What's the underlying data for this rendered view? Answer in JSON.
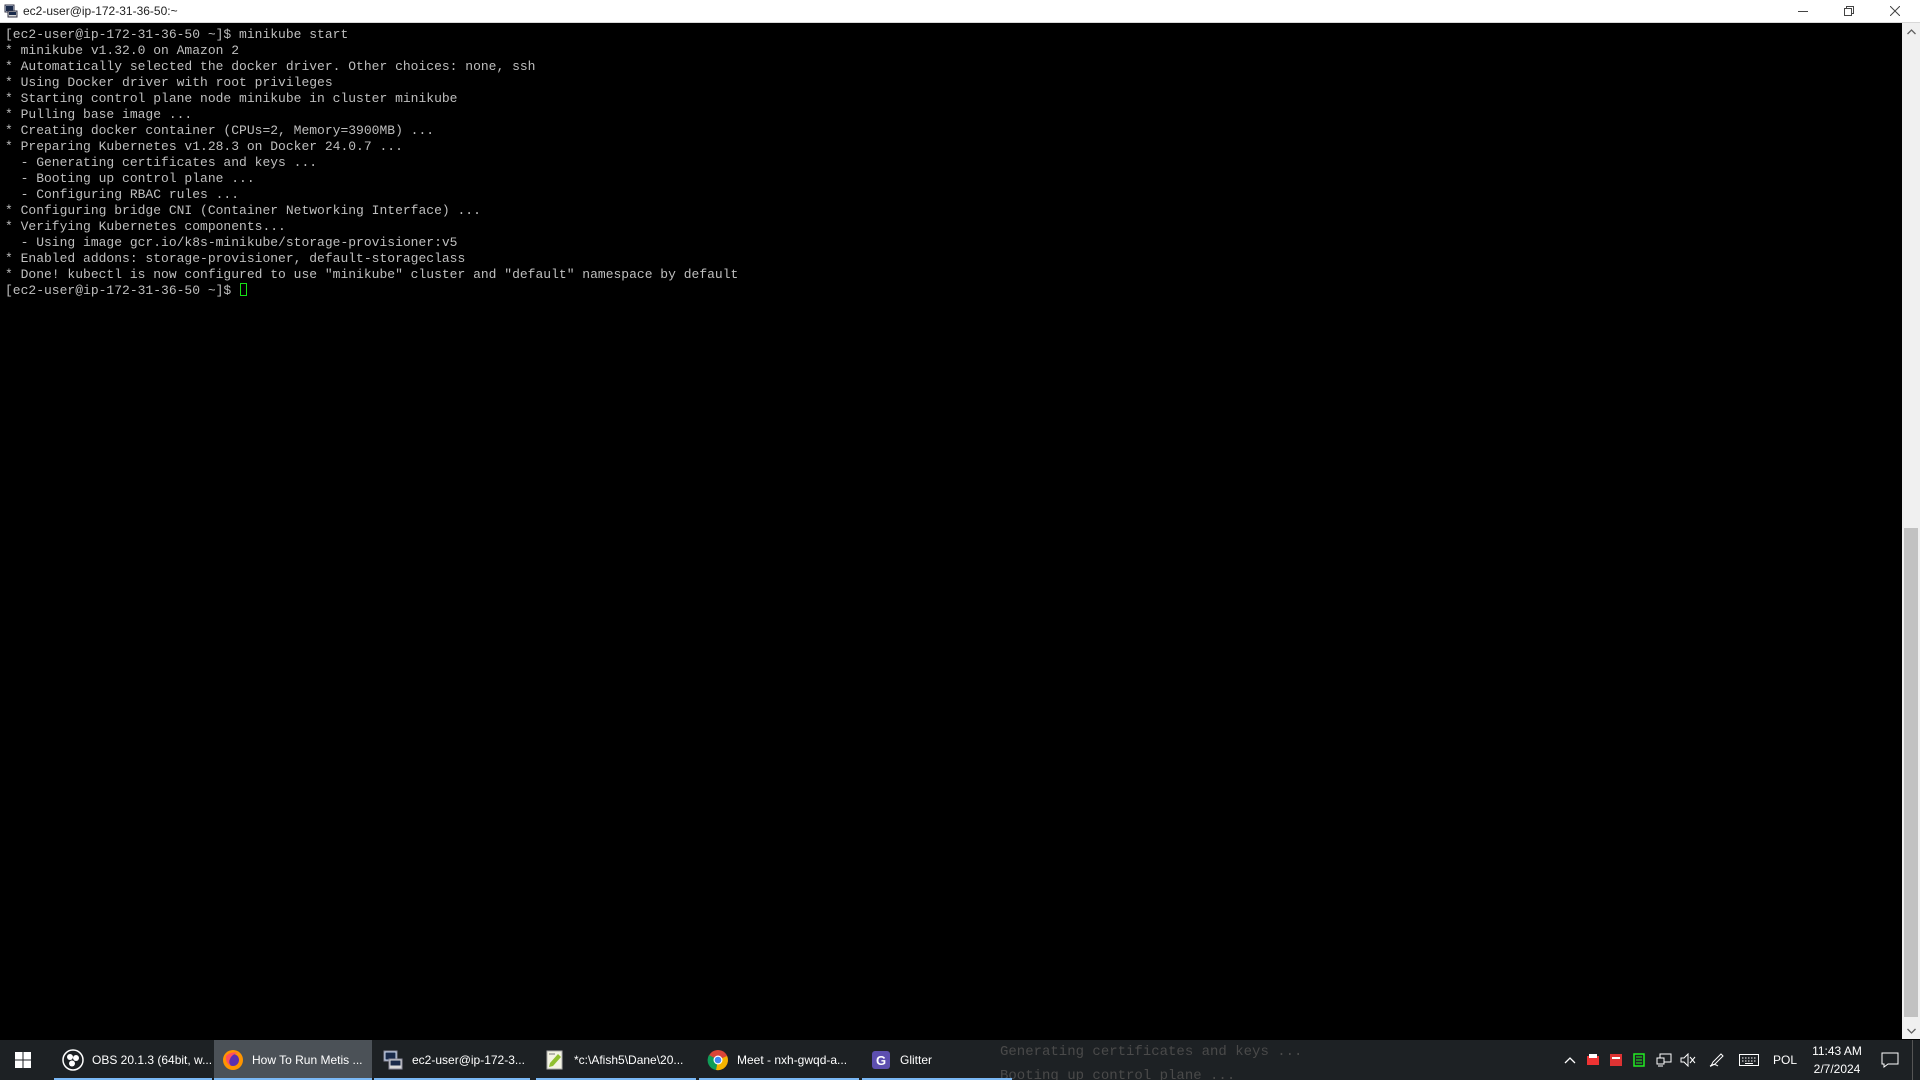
{
  "window": {
    "title": "ec2-user@ip-172-31-36-50:~"
  },
  "terminal": {
    "lines": [
      "[ec2-user@ip-172-31-36-50 ~]$ minikube start",
      "* minikube v1.32.0 on Amazon 2",
      "* Automatically selected the docker driver. Other choices: none, ssh",
      "* Using Docker driver with root privileges",
      "* Starting control plane node minikube in cluster minikube",
      "* Pulling base image ...",
      "* Creating docker container (CPUs=2, Memory=3900MB) ...",
      "* Preparing Kubernetes v1.28.3 on Docker 24.0.7 ...",
      "  - Generating certificates and keys ...",
      "  - Booting up control plane ...",
      "  - Configuring RBAC rules ...",
      "* Configuring bridge CNI (Container Networking Interface) ...",
      "* Verifying Kubernetes components...",
      "  - Using image gcr.io/k8s-minikube/storage-provisioner:v5",
      "* Enabled addons: storage-provisioner, default-storageclass",
      "* Done! kubectl is now configured to use \"minikube\" cluster and \"default\" namespace by default"
    ],
    "prompt": "[ec2-user@ip-172-31-36-50 ~]$ "
  },
  "taskbar": {
    "items": [
      {
        "label": "OBS 20.1.3 (64bit, w...",
        "icon": "obs-icon"
      },
      {
        "label": "How To Run Metis ...",
        "icon": "firefox-icon",
        "active": true
      },
      {
        "label": "ec2-user@ip-172-3...",
        "icon": "putty-icon"
      },
      {
        "label": "*c:\\Afish5\\Dane\\20...",
        "icon": "notepad-plus-icon"
      },
      {
        "label": "Meet - nxh-gwqd-a...",
        "icon": "chrome-icon"
      },
      {
        "label": "Glitter",
        "icon": "glitter-icon"
      }
    ],
    "ghost_lines": [
      "Generating certificates and keys ...",
      "Booting up control plane ..."
    ],
    "language": "POL",
    "time": "11:43 AM",
    "date": "2/7/2024"
  },
  "colors": {
    "terminal_bg": "#000000",
    "terminal_fg": "#bfbfbf",
    "cursor": "#16e016",
    "taskbar_bg": "#1d2124",
    "taskbar_accent": "#7ab8f5"
  }
}
